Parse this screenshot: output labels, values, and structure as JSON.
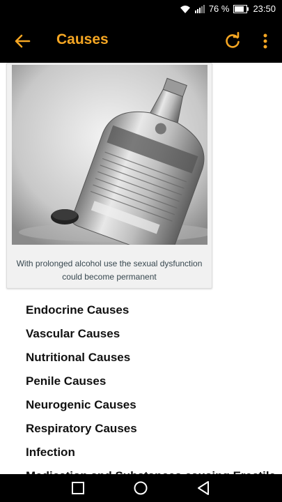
{
  "status_bar": {
    "battery": "76 %",
    "time": "23:50"
  },
  "app_bar": {
    "title": "Causes"
  },
  "card": {
    "caption": "With prolonged alcohol use the sexual dysfunction could become permanent"
  },
  "topics": [
    "Endocrine Causes",
    "Vascular Causes",
    "Nutritional Causes",
    "Penile Causes",
    "Neurogenic Causes",
    "Respiratory Causes",
    "Infection",
    "Medication and Substances causing Erectile"
  ],
  "colors": {
    "accent": "#f5a623",
    "bar": "#000000"
  },
  "icons": [
    "back-arrow-icon",
    "refresh-icon",
    "more-vert-icon",
    "recent-apps-icon",
    "home-icon",
    "back-nav-icon",
    "wifi-icon",
    "signal-icon",
    "battery-icon"
  ]
}
